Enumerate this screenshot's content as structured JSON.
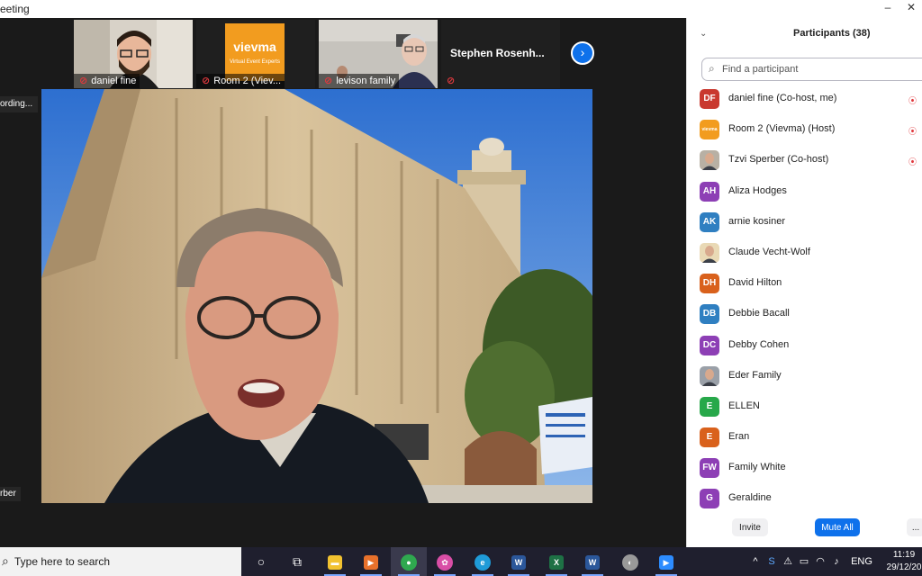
{
  "window": {
    "title": "eeting",
    "minimize_label": "–",
    "close_label": "✕"
  },
  "meeting": {
    "thumbnails": [
      {
        "name": "daniel fine",
        "muted": true
      },
      {
        "name": "Room 2 (Viev...",
        "muted": true,
        "logo_text": "vievma",
        "logo_sub": "Virtual Event Experts"
      },
      {
        "name": "levison family",
        "muted": true
      },
      {
        "name": "Stephen Rosenh...",
        "muted": true
      }
    ],
    "next_label": "›",
    "recording_label": "ording...",
    "speaker_label": "rber"
  },
  "participants": {
    "title": "Participants (38)",
    "search_placeholder": "Find a participant",
    "list": [
      {
        "initials": "DF",
        "name": "daniel fine (Co-host, me)",
        "color": "#c9392f",
        "recording": true
      },
      {
        "initials": "vievma",
        "name": "Room 2 (Vievma) (Host)",
        "color": "#f29c1f",
        "recording": true,
        "kind": "logo"
      },
      {
        "initials": "",
        "name": "Tzvi Sperber (Co-host)",
        "color": "#b8b0a4",
        "recording": true,
        "kind": "photo"
      },
      {
        "initials": "AH",
        "name": "Aliza Hodges",
        "color": "#8d3fb5"
      },
      {
        "initials": "AK",
        "name": "arnie kosiner",
        "color": "#2f7fc1"
      },
      {
        "initials": "",
        "name": "Claude Vecht-Wolf",
        "color": "#e9d9b5",
        "kind": "photo"
      },
      {
        "initials": "DH",
        "name": "David Hilton",
        "color": "#d9611c"
      },
      {
        "initials": "DB",
        "name": "Debbie Bacall",
        "color": "#2f7fc1"
      },
      {
        "initials": "DC",
        "name": "Debby Cohen",
        "color": "#8d3fb5"
      },
      {
        "initials": "",
        "name": "Eder Family",
        "color": "#9aa0a8",
        "kind": "photo"
      },
      {
        "initials": "E",
        "name": "ELLEN",
        "color": "#27a84a"
      },
      {
        "initials": "E",
        "name": "Eran",
        "color": "#d9611c"
      },
      {
        "initials": "FW",
        "name": "Family White",
        "color": "#8d3fb5"
      },
      {
        "initials": "G",
        "name": "Geraldine",
        "color": "#8d3fb5"
      }
    ],
    "invite_label": "Invite",
    "mute_all_label": "Mute All",
    "more_label": "..."
  },
  "taskbar": {
    "search_text": "Type here to search",
    "apps": [
      {
        "name": "cortana",
        "glyph": "○"
      },
      {
        "name": "task-view",
        "glyph": "⧉"
      },
      {
        "name": "file-explorer",
        "glyph": "▬",
        "color": "#f2c230"
      },
      {
        "name": "media-player",
        "glyph": "▶",
        "color": "#e8712b"
      },
      {
        "name": "chrome",
        "glyph": "●",
        "color": "#2fa84f"
      },
      {
        "name": "photos",
        "glyph": "✿",
        "color": "#d94ea6"
      },
      {
        "name": "edge",
        "glyph": "e",
        "color": "#1f9bd8"
      },
      {
        "name": "word",
        "glyph": "W",
        "color": "#2b579a"
      },
      {
        "name": "excel",
        "glyph": "X",
        "color": "#1e7145"
      },
      {
        "name": "word-2",
        "glyph": "W",
        "color": "#2b579a"
      },
      {
        "name": "app-generic",
        "glyph": "◐",
        "color": "#999999"
      },
      {
        "name": "zoom",
        "glyph": "▶",
        "color": "#2d8cff"
      }
    ],
    "tray": {
      "chevron": "^",
      "lang": "ENG",
      "time": "11:19",
      "date": "29/12/20"
    }
  }
}
